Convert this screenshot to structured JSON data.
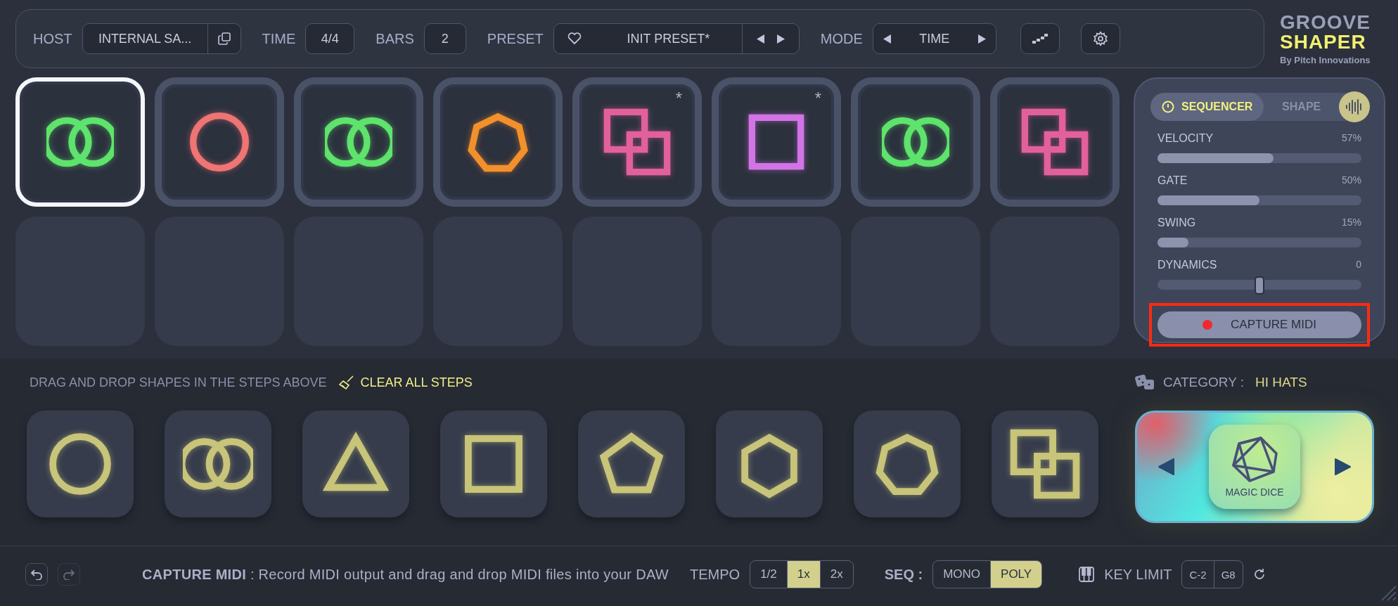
{
  "header": {
    "host": {
      "label": "HOST",
      "value": "INTERNAL SA..."
    },
    "time": {
      "label": "TIME",
      "value": "4/4"
    },
    "bars": {
      "label": "BARS",
      "value": "2"
    },
    "preset": {
      "label": "PRESET",
      "name": "INIT PRESET*"
    },
    "mode": {
      "label": "MODE",
      "value": "TIME"
    }
  },
  "logo": {
    "line1": "GROOVE",
    "line2": "SHAPER",
    "byline": "By Pitch Innovations"
  },
  "steps": [
    {
      "kind": "rings",
      "color": "#5ee36c",
      "selected": true
    },
    {
      "kind": "circle",
      "color": "#ef7474",
      "selected": false
    },
    {
      "kind": "rings",
      "color": "#5ee36c",
      "selected": false
    },
    {
      "kind": "heptagon",
      "color": "#f3902c",
      "selected": false
    },
    {
      "kind": "squares",
      "color": "#e2609c",
      "selected": false,
      "mark": "*"
    },
    {
      "kind": "square",
      "color": "#d274e6",
      "selected": false,
      "mark": "*"
    },
    {
      "kind": "rings",
      "color": "#5ee36c",
      "selected": false
    },
    {
      "kind": "squares",
      "color": "#e2609c",
      "selected": false
    },
    {
      "kind": "empty"
    },
    {
      "kind": "empty"
    },
    {
      "kind": "empty"
    },
    {
      "kind": "empty"
    },
    {
      "kind": "empty"
    },
    {
      "kind": "empty"
    },
    {
      "kind": "empty"
    },
    {
      "kind": "empty"
    }
  ],
  "panel": {
    "tabs": [
      {
        "label": "SEQUENCER",
        "selected": true
      },
      {
        "label": "SHAPE",
        "selected": false
      }
    ],
    "sliders": [
      {
        "kind": "bar",
        "label": "VELOCITY",
        "reading": "57%",
        "level": 0.57
      },
      {
        "kind": "bar",
        "label": "GATE",
        "reading": "50%",
        "level": 0.5
      },
      {
        "kind": "bar",
        "label": "SWING",
        "reading": "15%",
        "level": 0.15
      },
      {
        "kind": "center",
        "label": "DYNAMICS",
        "reading": "0",
        "level": 0.5
      }
    ],
    "capture_button": "CAPTURE MIDI"
  },
  "palette": {
    "instruction": "DRAG AND DROP SHAPES IN THE STEPS ABOVE",
    "clear": "CLEAR ALL STEPS",
    "shapes": [
      {
        "kind": "circle"
      },
      {
        "kind": "rings"
      },
      {
        "kind": "triangle"
      },
      {
        "kind": "square"
      },
      {
        "kind": "pentagon"
      },
      {
        "kind": "hexagon"
      },
      {
        "kind": "heptagon"
      },
      {
        "kind": "squares"
      }
    ],
    "category": {
      "label": "CATEGORY :",
      "value": "HI HATS"
    },
    "dice_label": "MAGIC DICE"
  },
  "footer": {
    "history": [
      {
        "kind": "undo",
        "disabled": false
      },
      {
        "kind": "redo",
        "disabled": true
      }
    ],
    "hint_title": "CAPTURE MIDI",
    "hint_text": ": Record MIDI output and drag and drop MIDI files into your DAW",
    "tempo": {
      "label": "TEMPO",
      "options": [
        {
          "label": "1/2",
          "selected": false
        },
        {
          "label": "1x",
          "selected": true
        },
        {
          "label": "2x",
          "selected": false
        }
      ]
    },
    "seq": {
      "label": "SEQ :",
      "options": [
        {
          "label": "MONO",
          "selected": false
        },
        {
          "label": "POLY",
          "selected": true
        }
      ]
    },
    "key_limit": {
      "label": "KEY LIMIT",
      "low": "C-2",
      "high": "G8"
    }
  }
}
